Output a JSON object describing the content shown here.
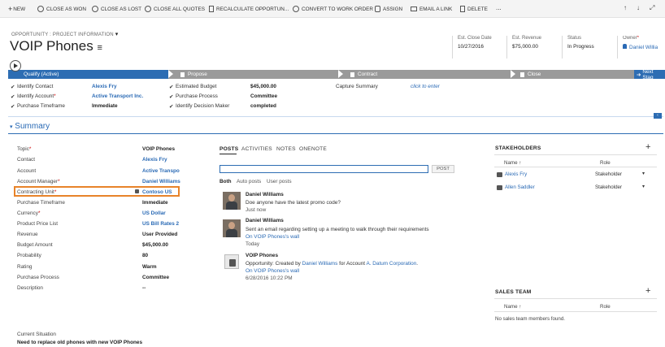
{
  "toolbar": {
    "new": "NEW",
    "close_won": "CLOSE AS WON",
    "close_lost": "CLOSE AS LOST",
    "close_quotes": "CLOSE ALL QUOTES",
    "recalculate": "RECALCULATE OPPORTUN...",
    "convert": "CONVERT TO WORK ORDER",
    "assign": "ASSIGN",
    "email_link": "EMAIL A LINK",
    "delete": "DELETE",
    "more": "...",
    "nav_up": "↑",
    "nav_down": "↓",
    "expand": "⤢"
  },
  "header": {
    "breadcrumb": "OPPORTUNITY : PROJECT INFORMATION",
    "form_chevron": "▾",
    "title": "VOIP Phones",
    "menu_icon": "≡",
    "close_date_label": "Est. Close Date",
    "close_date": "10/27/2016",
    "revenue_label": "Est. Revenue",
    "revenue": "$75,000.00",
    "status_label": "Status",
    "status": "In Progress",
    "owner_label": "Owner",
    "owner": "Daniel Willia"
  },
  "process": {
    "stages": [
      "Qualify (Active)",
      "Propose",
      "Contract",
      "Close"
    ],
    "next_stage": "Next Stag",
    "col1": [
      {
        "label": "Identify Contact",
        "value": "Alexis Fry",
        "link": true,
        "req": false
      },
      {
        "label": "Identify Account",
        "value": "Active Transport Inc.",
        "link": true,
        "req": true
      },
      {
        "label": "Purchase Timeframe",
        "value": "Immediate",
        "link": false,
        "req": false
      }
    ],
    "col2": [
      {
        "label": "Estimated Budget",
        "value": "$45,000.00"
      },
      {
        "label": "Purchase Process",
        "value": "Committee"
      },
      {
        "label": "Identify Decision Maker",
        "value": "completed"
      }
    ],
    "capture_label": "Capture Summary",
    "capture_value": "click to enter"
  },
  "summary": {
    "title": "Summary",
    "fields": [
      {
        "label": "Topic",
        "value": "VOIP Phones",
        "req": true,
        "link": false
      },
      {
        "label": "Contact",
        "value": "Alexis Fry",
        "req": false,
        "link": true
      },
      {
        "label": "Account",
        "value": "Active Transpo",
        "req": false,
        "link": true
      },
      {
        "label": "Account Manager",
        "value": "Daniel Williams",
        "req": true,
        "link": true
      },
      {
        "label": "Contracting Unit",
        "value": "Contoso US",
        "req": true,
        "link": true
      },
      {
        "label": "Purchase Timeframe",
        "value": "Immediate",
        "req": false,
        "link": false
      },
      {
        "label": "Currency",
        "value": "US Dollar",
        "req": true,
        "link": true
      },
      {
        "label": "Product Price List",
        "value": "US Bill Rates 2",
        "req": false,
        "link": true
      },
      {
        "label": "Revenue",
        "value": "User Provided",
        "req": false,
        "link": false
      },
      {
        "label": "Budget Amount",
        "value": "$45,000.00",
        "req": false,
        "link": false
      },
      {
        "label": "Probability",
        "value": "80",
        "req": false,
        "link": false
      },
      {
        "label": "Rating",
        "value": "Warm",
        "req": false,
        "link": false
      },
      {
        "label": "Purchase Process",
        "value": "Committee",
        "req": false,
        "link": false
      },
      {
        "label": "Description",
        "value": "--",
        "req": false,
        "link": false
      }
    ],
    "current_situation_label": "Current Situation",
    "current_situation": "Need to replace old phones with new VOIP Phones"
  },
  "social": {
    "tabs": [
      "POSTS",
      "ACTIVITIES",
      "NOTES",
      "ONENOTE"
    ],
    "post_button": "POST",
    "filters": [
      "Both",
      "Auto posts",
      "User posts"
    ],
    "posts": [
      {
        "author": "Daniel Williams",
        "text": "Doe anyone have the latest promo code?",
        "meta": "Just now"
      },
      {
        "author": "Daniel Williams",
        "text": "Sent an email regarding setting up a meeting to walk through their requirements",
        "wall": "On VOIP Phones's wall",
        "meta": "Today"
      },
      {
        "author": "VOIP Phones",
        "text_pre": "Opportunity: Created by ",
        "text_user": "Daniel Williams",
        "text_mid": " for Account ",
        "text_acc": "A. Datum Corporation",
        "text_end": ".",
        "wall": "On VOIP Phones's wall",
        "meta": "6/28/2016 10:22 PM"
      }
    ]
  },
  "stakeholders": {
    "title": "STAKEHOLDERS",
    "add": "+",
    "col_name": "Name ↑",
    "col_role": "Role",
    "rows": [
      {
        "name": "Alexis Fry",
        "role": "Stakeholder"
      },
      {
        "name": "Allen Saddler",
        "role": "Stakeholder"
      }
    ]
  },
  "sales_team": {
    "title": "SALES TEAM",
    "add": "+",
    "col_name": "Name ↑",
    "col_role": "Role",
    "empty": "No sales team members found."
  },
  "colors": {
    "accent": "#2d6db3",
    "highlight_box": "#e8832a",
    "link": "#2a6ab5"
  }
}
